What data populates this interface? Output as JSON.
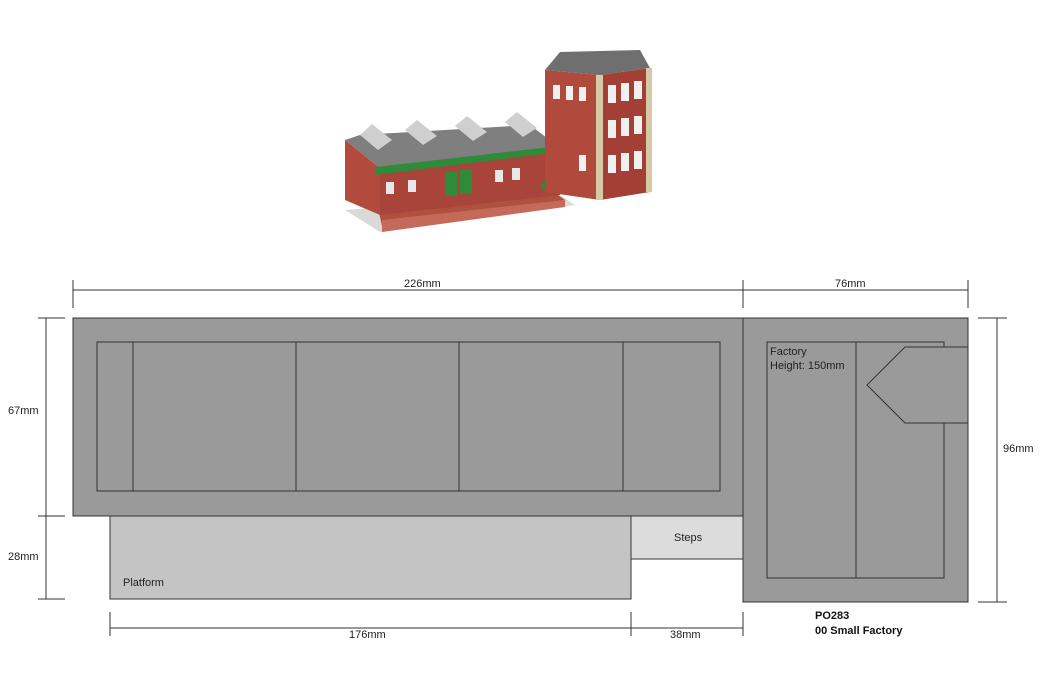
{
  "dimensions": {
    "top_left": "226mm",
    "top_right": "76mm",
    "left_upper": "67mm",
    "left_lower": "28mm",
    "right": "96mm",
    "bottom_left": "176mm",
    "bottom_right": "38mm"
  },
  "labels": {
    "factory_line1": "Factory",
    "factory_line2": "Height: 150mm",
    "steps": "Steps",
    "platform": "Platform",
    "product_code": "PO283",
    "product_name": "00 Small Factory"
  },
  "colors": {
    "main_building": "#9a9a9a",
    "platform": "#c4c4c4",
    "steps": "#dcdcdc",
    "outline": "#333333",
    "brick": "#a8443a",
    "green_trim": "#2f8a3a"
  }
}
